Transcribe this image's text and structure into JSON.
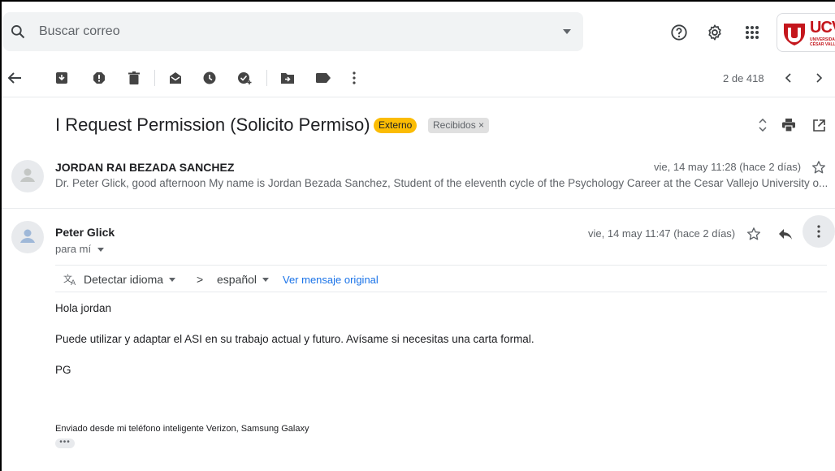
{
  "search": {
    "placeholder": "Buscar correo"
  },
  "pager": {
    "text": "2 de 418"
  },
  "logo": {
    "text": "UCV",
    "sub": "UNIVERSIDAD\nCÉSAR VALLEJO"
  },
  "thread": {
    "subject": "I Request Permission (Solicito Permiso)",
    "labels": {
      "external": "Externo",
      "inbox": "Recibidos ×"
    }
  },
  "message1": {
    "sender": "JORDAN RAI BEZADA SANCHEZ",
    "date": "vie, 14 may 11:28 (hace 2 días)",
    "snippet": "Dr. Peter Glick, good afternoon My name is Jordan Bezada Sanchez, Student of the eleventh cycle of the Psychology Career at the Cesar Vallejo University o..."
  },
  "message2": {
    "sender": "Peter Glick",
    "recipient": "para mí",
    "date": "vie, 14 may 11:47 (hace 2 días)",
    "translate": {
      "detect": "Detectar idioma",
      "arrow": ">",
      "target": "español",
      "original": "Ver mensaje original"
    },
    "body": [
      "Hola jordan",
      "Puede utilizar y adaptar el ASI en su trabajo actual y futuro. Avísame si necesitas una carta formal.",
      "PG"
    ],
    "signature": "Enviado desde mi teléfono inteligente Verizon, Samsung Galaxy",
    "trimmed": "•••"
  },
  "colors": {
    "accent": "#1a73e8",
    "external_badge": "#fbbc04",
    "logo_red": "#c4161c"
  }
}
